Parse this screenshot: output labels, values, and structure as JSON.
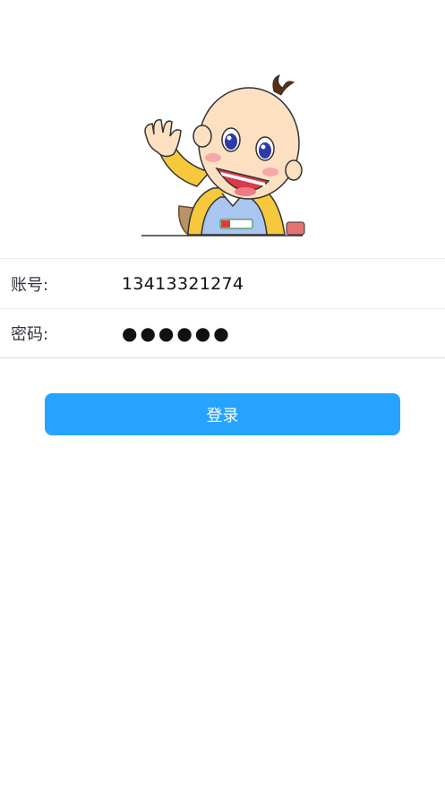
{
  "form": {
    "account_label": "账号:",
    "account_value": "13413321274",
    "password_label": "密码:",
    "password_masked": "●●●●●●"
  },
  "login_button": "登录",
  "colors": {
    "accent": "#26a2ff",
    "background": "#ffffff"
  }
}
